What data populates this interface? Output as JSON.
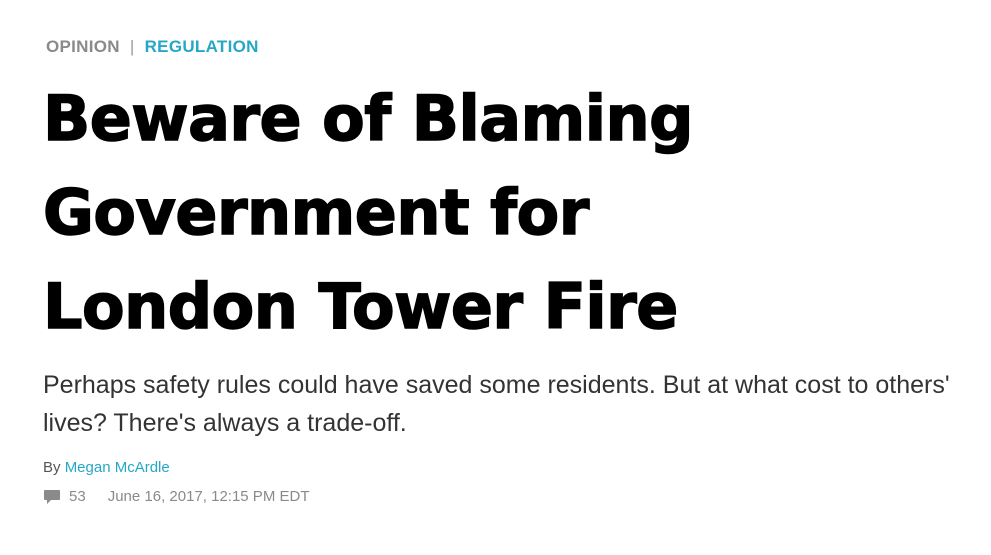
{
  "kicker": {
    "section": "OPINION",
    "divider": "|",
    "topic": "REGULATION"
  },
  "headline": {
    "lines": [
      "Beware of Blaming",
      "Government for",
      "London Tower Fire"
    ]
  },
  "dek": "Perhaps safety rules could have saved some residents. But at what cost to others' lives? There's always a trade-off.",
  "byline": {
    "prefix": "By",
    "author": "Megan McArdle"
  },
  "meta": {
    "comment_icon": "comment-bubble-icon",
    "comment_count": "53",
    "timestamp": "June 16, 2017, 12:15 PM EDT"
  },
  "colors": {
    "accent": "#27a7c8",
    "headline": "#000000",
    "muted": "#8a8a8a"
  }
}
